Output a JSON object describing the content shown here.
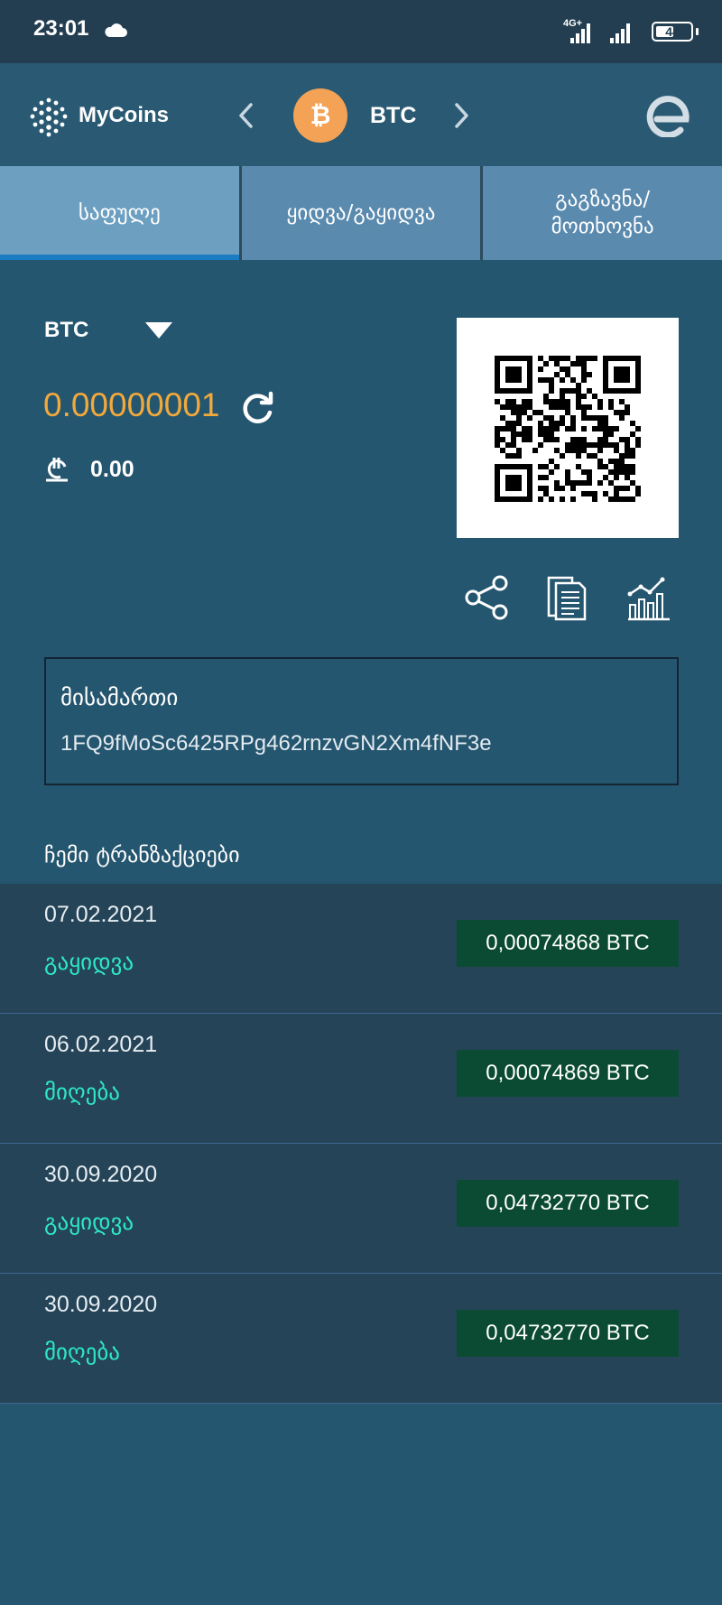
{
  "status_bar": {
    "time": "23:01",
    "network": "4G+",
    "battery": "44"
  },
  "header": {
    "logo_text": "MyCoins",
    "coin_symbol": "₿",
    "coin_name": "BTC"
  },
  "tabs": [
    {
      "label": "საფულე",
      "active": true
    },
    {
      "label": "ყიდვა/გაყიდვა",
      "active": false
    },
    {
      "label": "გაგზავნა/\nმოთხოვნა",
      "active": false
    }
  ],
  "wallet": {
    "currency": "BTC",
    "balance": "0.00000001",
    "fiat_value": "0.00",
    "fiat_icon": "lari-icon"
  },
  "address": {
    "label": "მისამართი",
    "value": "1FQ9fMoSc6425RPg462rnzvGN2Xm4fNF3e"
  },
  "transactions": {
    "heading": "ჩემი ტრანზაქციები",
    "items": [
      {
        "date": "07.02.2021",
        "type": "გაყიდვა",
        "amount": "0,00074868 BTC"
      },
      {
        "date": "06.02.2021",
        "type": "მიღება",
        "amount": "0,00074869 BTC"
      },
      {
        "date": "30.09.2020",
        "type": "გაყიდვა",
        "amount": "0,04732770 BTC"
      },
      {
        "date": "30.09.2020",
        "type": "მიღება",
        "amount": "0,04732770 BTC"
      }
    ]
  },
  "colors": {
    "background": "#25566f",
    "balance": "#f2a93c",
    "tx_type": "#2ee8c5",
    "amount_badge": "#0b4b33",
    "coin_badge": "#f4a256"
  }
}
